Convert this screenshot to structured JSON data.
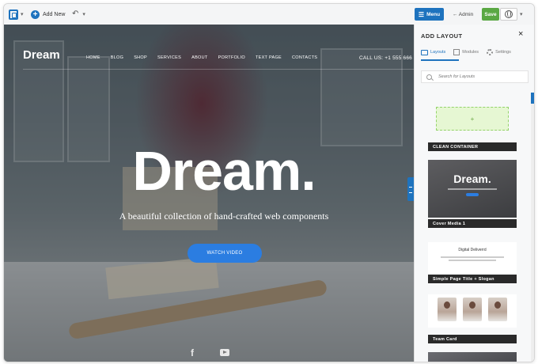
{
  "toolbar": {
    "add_new": "Add New",
    "menu": "Menu",
    "admin": "← Admin",
    "save": "Save"
  },
  "site": {
    "brand": "Dream",
    "nav": [
      "HOME",
      "BLOG",
      "SHOP",
      "SERVICES",
      "ABOUT",
      "PORTFOLIO",
      "TEXT PAGE",
      "CONTACTS"
    ],
    "call": "CALL US: +1 555 666",
    "hero_title": "Dream.",
    "hero_subtitle": "A beautiful collection of hand-crafted web components",
    "watch_video": "WATCH VIDEO"
  },
  "panel": {
    "title": "ADD LAYOUT",
    "tabs": [
      {
        "label": "Layouts",
        "icon": "layout-icon"
      },
      {
        "label": "Modules",
        "icon": "modules-icon"
      },
      {
        "label": "Settings",
        "icon": "gear-icon"
      }
    ],
    "search_placeholder": "Search for Layouts",
    "cards": [
      {
        "label": "CLEAN CONTAINER"
      },
      {
        "label": "Cover Media 1",
        "preview_title": "Dream."
      },
      {
        "label": "Simple Page Title + Slogan",
        "preview_title": "Digital Deliverrd"
      },
      {
        "label": "Team Card"
      }
    ]
  },
  "colors": {
    "accent": "#1e73be",
    "save": "#5aa843",
    "button_blue": "#2b7de1"
  }
}
